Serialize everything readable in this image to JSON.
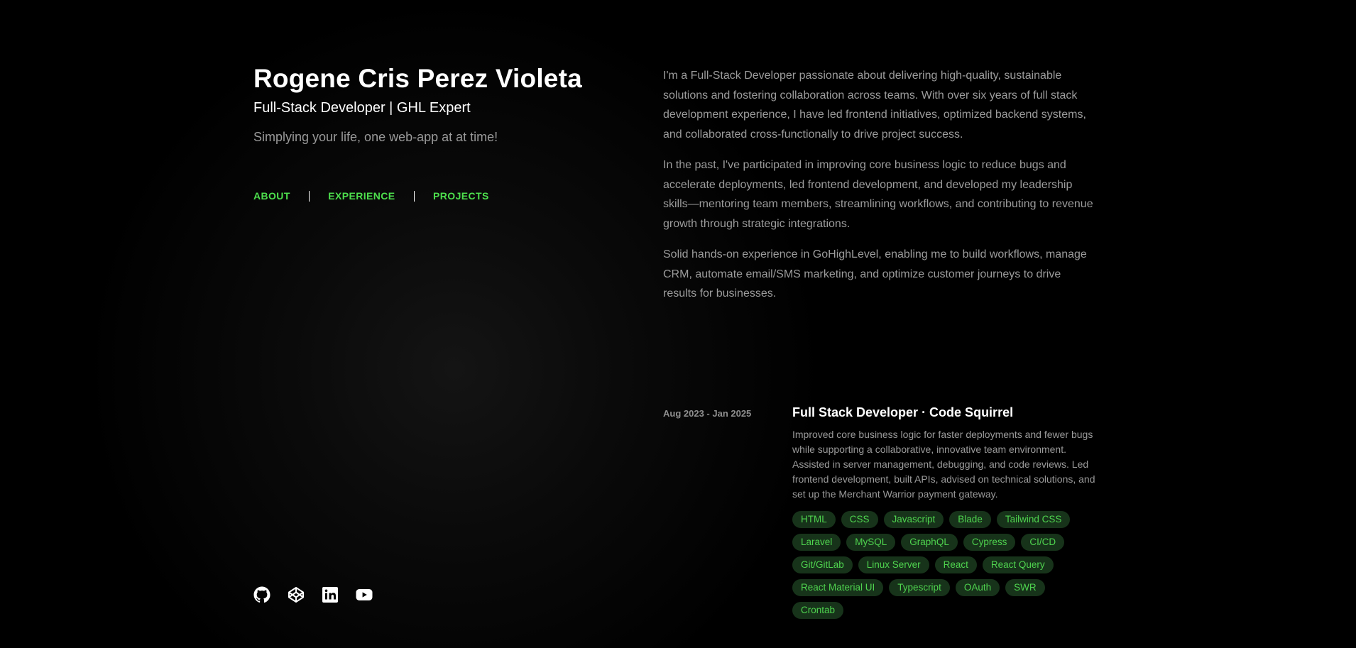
{
  "header": {
    "name": "Rogene Cris Perez Violeta",
    "role": "Full-Stack Developer | GHL Expert",
    "tagline": "Simplying your life, one web-app at at time!"
  },
  "nav": {
    "items": [
      {
        "label": "ABOUT"
      },
      {
        "label": "EXPERIENCE"
      },
      {
        "label": "PROJECTS"
      }
    ]
  },
  "social": [
    "github-icon",
    "codepen-icon",
    "linkedin-icon",
    "youtube-icon"
  ],
  "about": {
    "paragraphs": [
      "I'm a Full-Stack Developer passionate about delivering high-quality, sustainable solutions and fostering collaboration across teams. With over six years of full stack development experience, I have led frontend initiatives, optimized backend systems, and collaborated cross-functionally to drive project success.",
      "In the past, I've participated in improving core business logic to reduce bugs and accelerate deployments, led frontend development, and developed my leadership skills—mentoring team members, streamlining workflows, and contributing to revenue growth through strategic integrations.",
      "Solid hands-on experience in GoHighLevel, enabling me to build workflows, manage CRM, automate email/SMS marketing, and optimize customer journeys to drive results for businesses."
    ]
  },
  "experience": {
    "date": "Aug 2023 - Jan 2025",
    "title": "Full Stack Developer · Code Squirrel",
    "description": "Improved core business logic for faster deployments and fewer bugs while supporting a collaborative, innovative team environment. Assisted in server management, debugging, and code reviews. Led frontend development, built APIs, advised on technical solutions, and set up the Merchant Warrior payment gateway.",
    "tags": [
      "HTML",
      "CSS",
      "Javascript",
      "Blade",
      "Tailwind CSS",
      "Laravel",
      "MySQL",
      "GraphQL",
      "Cypress",
      "CI/CD",
      "Git/GitLab",
      "Linux Server",
      "React",
      "React Query",
      "React Material UI",
      "Typescript",
      "OAuth",
      "SWR",
      "Crontab"
    ]
  },
  "colors": {
    "accent": "#4ddf4d",
    "tag_bg": "#17331a",
    "text_muted": "#9c9c9c",
    "background": "#000000"
  }
}
